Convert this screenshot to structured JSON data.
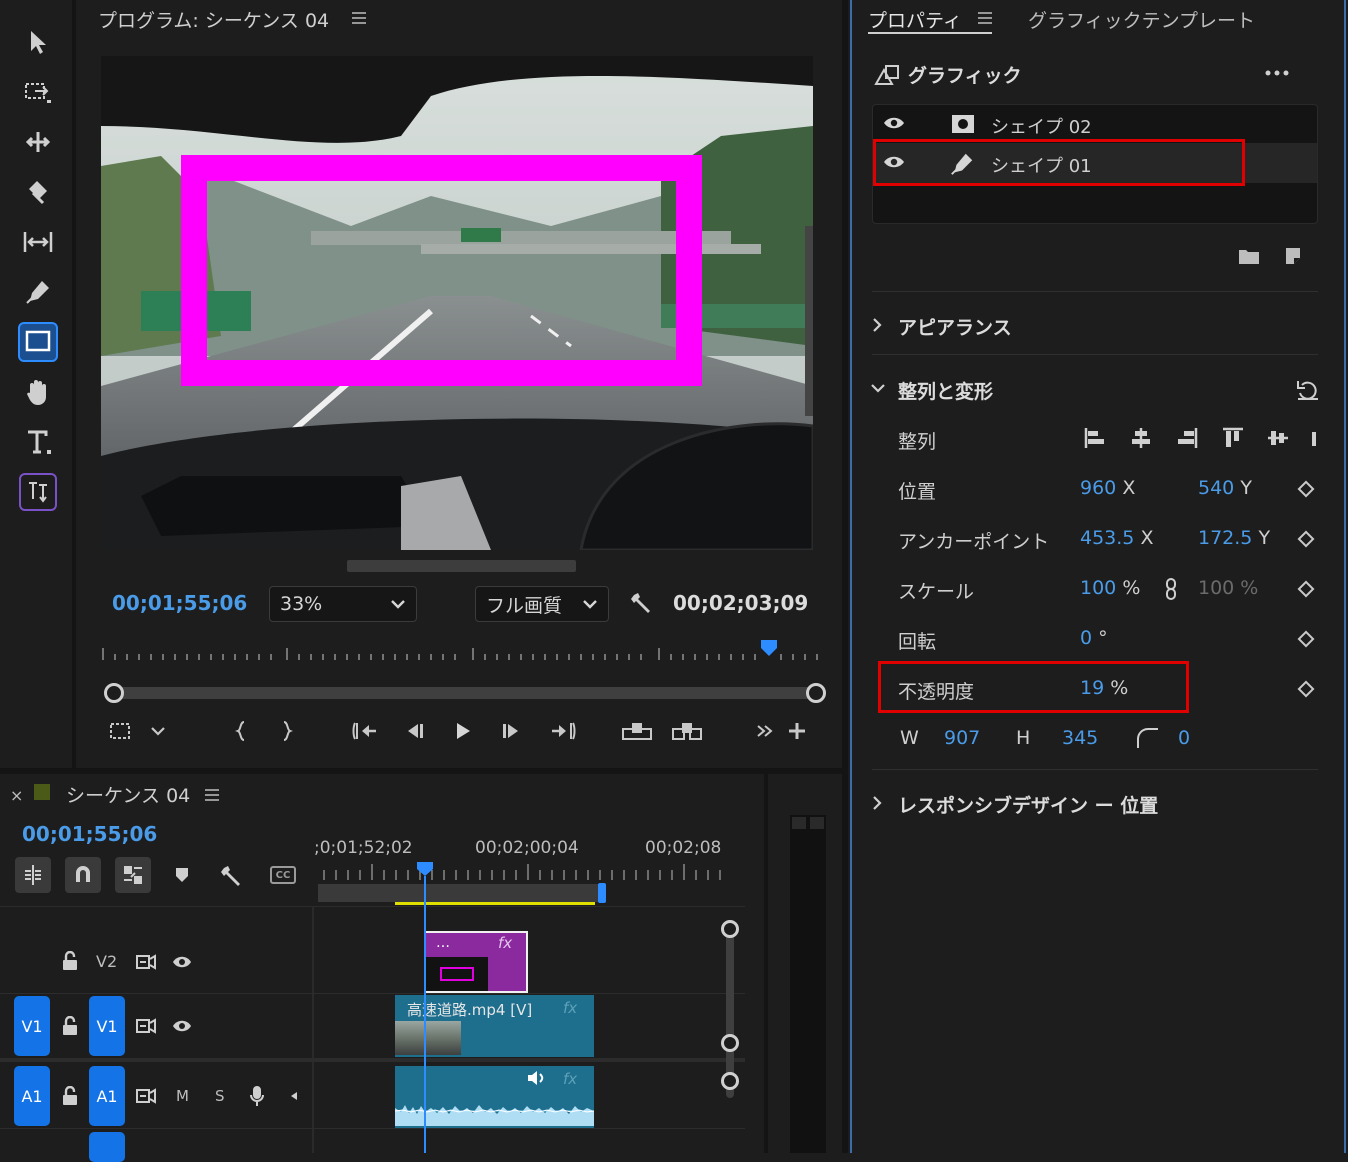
{
  "program_monitor": {
    "title": "プログラム: シーケンス 04",
    "timecode_current": "00;01;55;06",
    "zoom": "33%",
    "quality": "フル画質",
    "timecode_duration": "00;02;03;09"
  },
  "properties_panel": {
    "tab_properties": "プロパティ",
    "tab_templates": "グラフィックテンプレート",
    "section_graphic": "グラフィック",
    "layers": [
      {
        "name": "シェイプ 02"
      },
      {
        "name": "シェイプ 01"
      }
    ],
    "appearance": "アピアランス",
    "align_transform": "整列と変形",
    "align_label": "整列",
    "position_label": "位置",
    "position_x": "960",
    "position_y": "540",
    "anchor_label": "アンカーポイント",
    "anchor_x": "453.5",
    "anchor_y": "172.5",
    "scale_label": "スケール",
    "scale_value": "100",
    "scale_value2": "100 %",
    "rotation_label": "回転",
    "rotation_value": "0",
    "rotation_unit": "°",
    "opacity_label": "不透明度",
    "opacity_value": "19",
    "pct": "%",
    "x_unit": "X",
    "y_unit": "Y",
    "w_label": "W",
    "w_value": "907",
    "h_label": "H",
    "h_value": "345",
    "corner_value": "0",
    "responsive": "レスポンシブデザイン ー 位置"
  },
  "timeline": {
    "title": "シーケンス 04",
    "close": "×",
    "timecode": "00;01;55;06",
    "ruler_labels": [
      ";0;01;52;02",
      "00;02;00;04",
      "00;02;08"
    ],
    "tracks": {
      "v2": "V2",
      "v1": "V1",
      "a1": "A1",
      "m": "M",
      "s": "S"
    },
    "clip_video_name": "高速道路.mp4 [V]",
    "fx": "fx",
    "cc": "CC"
  },
  "colors": {
    "accent_blue": "#1473e6",
    "highlight_red": "#e00000",
    "shape_magenta": "#ff00ff",
    "clip_purple": "#8a2a9e",
    "clip_teal": "#1e6f8e"
  }
}
